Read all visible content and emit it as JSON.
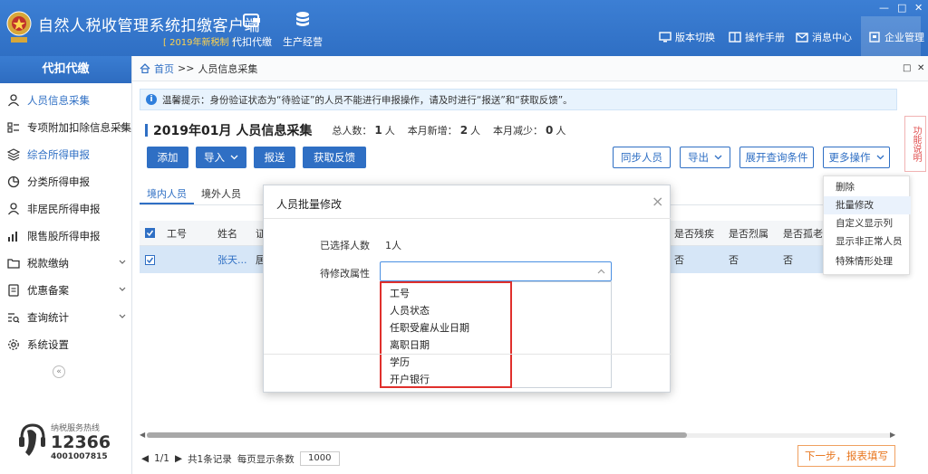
{
  "header": {
    "title": "自然人税收管理系统扣缴客户端",
    "subtitle": "[ 2019年新税制 ]",
    "nav": [
      {
        "label": "代扣代缴",
        "icon": "wallet-icon"
      },
      {
        "label": "生产经营",
        "icon": "database-icon"
      }
    ],
    "right": [
      {
        "label": "版本切换",
        "icon": "monitor-icon"
      },
      {
        "label": "操作手册",
        "icon": "book-icon"
      },
      {
        "label": "消息中心",
        "icon": "mail-icon"
      },
      {
        "label": "企业管理",
        "icon": "building-icon"
      }
    ],
    "window": {
      "minimize": "—",
      "restore": "□",
      "close": "✕"
    }
  },
  "sidebar": {
    "title": "代扣代缴",
    "items": [
      {
        "label": "人员信息采集",
        "icon": "person-icon",
        "active": true,
        "chevron": false
      },
      {
        "label": "专项附加扣除信息采集",
        "icon": "list-icon",
        "active": false,
        "chevron": true
      },
      {
        "label": "综合所得申报",
        "icon": "layers-icon",
        "active": true,
        "chevron": false
      },
      {
        "label": "分类所得申报",
        "icon": "pie-icon",
        "active": false,
        "chevron": false
      },
      {
        "label": "非居民所得申报",
        "icon": "person-icon",
        "active": false,
        "chevron": false
      },
      {
        "label": "限售股所得申报",
        "icon": "bars-icon",
        "active": false,
        "chevron": false
      },
      {
        "label": "税款缴纳",
        "icon": "folder-icon",
        "active": false,
        "chevron": true
      },
      {
        "label": "优惠备案",
        "icon": "doc-icon",
        "active": false,
        "chevron": true
      },
      {
        "label": "查询统计",
        "icon": "search-list-icon",
        "active": false,
        "chevron": true
      },
      {
        "label": "系统设置",
        "icon": "gear-icon",
        "active": false,
        "chevron": false
      }
    ],
    "collapse": "«",
    "hotline": {
      "label": "纳税服务热线",
      "number": "12366",
      "tel": "4001007815"
    }
  },
  "main": {
    "breadcrumb": {
      "home": "首页",
      "sep": ">>",
      "current": "人员信息采集"
    },
    "notice": "温馨提示：身份验证状态为“待验证”的人员不能进行申报操作，请及时进行“报送”和“获取反馈”。",
    "func_side": "功能说明",
    "title": "2019年01月  人员信息采集",
    "stats": [
      {
        "label": "总人数：",
        "value": "1",
        "unit": "人"
      },
      {
        "label": "本月新增：",
        "value": "2",
        "unit": "人"
      },
      {
        "label": "本月减少：",
        "value": "0",
        "unit": "人"
      }
    ],
    "buttons": {
      "add": "添加",
      "import": "导入",
      "submit": "报送",
      "feedback": "获取反馈",
      "sync": "同步人员",
      "export": "导出",
      "expand_query": "展开查询条件",
      "more": "更多操作"
    },
    "tabs": [
      "境内人员",
      "境外人员"
    ],
    "columns": [
      "工号",
      "姓名",
      "证",
      "是否残疾",
      "是否烈属",
      "是否孤老"
    ],
    "rows": [
      {
        "checked": true,
        "id": "",
        "name": "张天...",
        "cert": "居",
        "disabled": "否",
        "martyr": "否",
        "elderly": "否"
      }
    ],
    "pager": {
      "page": "1/1",
      "total": "共1条记录",
      "per_page_label": "每页显示条数",
      "per_page": "1000"
    },
    "next_button": "下一步，报表填写"
  },
  "more_menu": {
    "items": [
      "删除",
      "批量修改",
      "自定义显示列",
      "显示非正常人员",
      "特殊情形处理"
    ],
    "highlighted": 1
  },
  "modal": {
    "title": "人员批量修改",
    "close": "×",
    "selected_label": "已选择人数",
    "selected_value": "1人",
    "attr_label": "待修改属性",
    "attr_value": "",
    "options": [
      "工号",
      "人员状态",
      "任职受雇从业日期",
      "离职日期",
      "学历",
      "开户银行"
    ]
  },
  "colors": {
    "primary": "#2f6fc4",
    "header": "#3c7fd4",
    "highlight_border": "#e0302c",
    "next_button": "#e8761e"
  }
}
